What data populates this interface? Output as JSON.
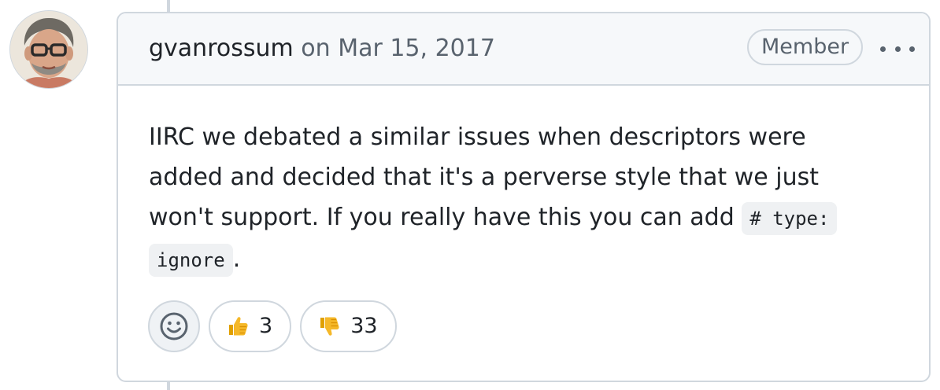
{
  "comment": {
    "author": "gvanrossum",
    "date_prefix": "on",
    "date": "Mar 15, 2017",
    "badge": "Member",
    "body": {
      "line1": "IIRC we debated a similar issues when descriptors were",
      "line2": "added and decided that it's a perverse style that we just",
      "line3": "won't support. If you really have this you can add",
      "code_part1": "# type:",
      "code_part2": "ignore",
      "end": "."
    },
    "reactions": [
      {
        "icon": "thumbs-up-icon",
        "count": "3"
      },
      {
        "icon": "thumbs-down-icon",
        "count": "33"
      }
    ]
  },
  "colors": {
    "border": "#d0d7de",
    "header_bg": "#f6f8fa",
    "muted_text": "#59636e",
    "text": "#1f2328",
    "code_bg": "#eff1f3",
    "thumb": "#f5b829"
  }
}
